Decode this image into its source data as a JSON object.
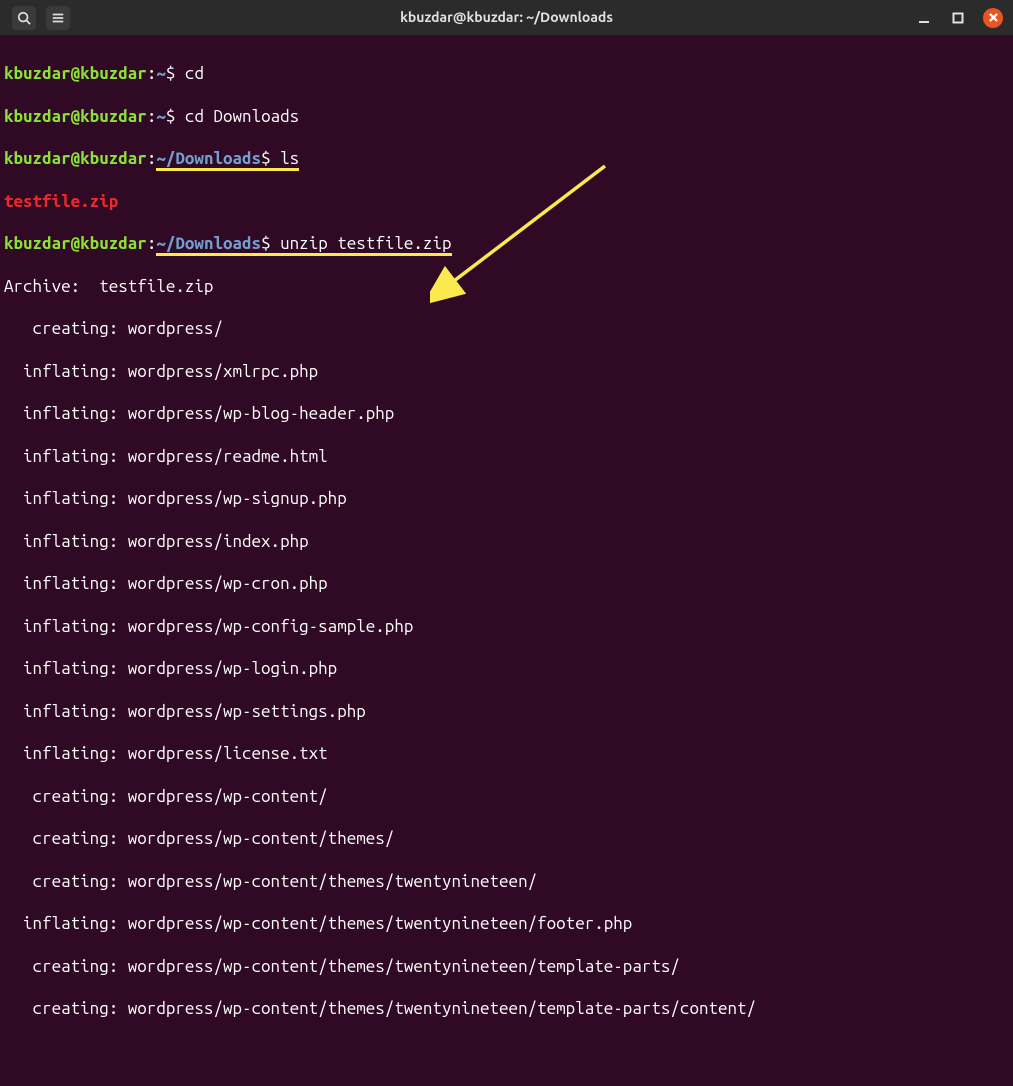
{
  "titlebar": {
    "title": "kbuzdar@kbuzdar: ~/Downloads"
  },
  "terminal": {
    "prompt_user": "kbuzdar@kbuzdar",
    "prompt_sep": ":",
    "path_home": "~",
    "path_downloads": "~/Downloads",
    "prompt_dollar": "$",
    "cmd1": " cd",
    "cmd2": " cd Downloads",
    "cmd3": " ls",
    "ls_output": "testfile.zip",
    "cmd4": " unzip testfile.zip",
    "unzip_lines": [
      "Archive:  testfile.zip",
      "   creating: wordpress/",
      "  inflating: wordpress/xmlrpc.php",
      "  inflating: wordpress/wp-blog-header.php",
      "  inflating: wordpress/readme.html",
      "  inflating: wordpress/wp-signup.php",
      "  inflating: wordpress/index.php",
      "  inflating: wordpress/wp-cron.php",
      "  inflating: wordpress/wp-config-sample.php",
      "  inflating: wordpress/wp-login.php",
      "  inflating: wordpress/wp-settings.php",
      "  inflating: wordpress/license.txt",
      "   creating: wordpress/wp-content/",
      "   creating: wordpress/wp-content/themes/",
      "   creating: wordpress/wp-content/themes/twentynineteen/",
      "  inflating: wordpress/wp-content/themes/twentynineteen/footer.php",
      "   creating: wordpress/wp-content/themes/twentynineteen/template-parts/",
      "   creating: wordpress/wp-content/themes/twentynineteen/template-parts/content/"
    ]
  }
}
